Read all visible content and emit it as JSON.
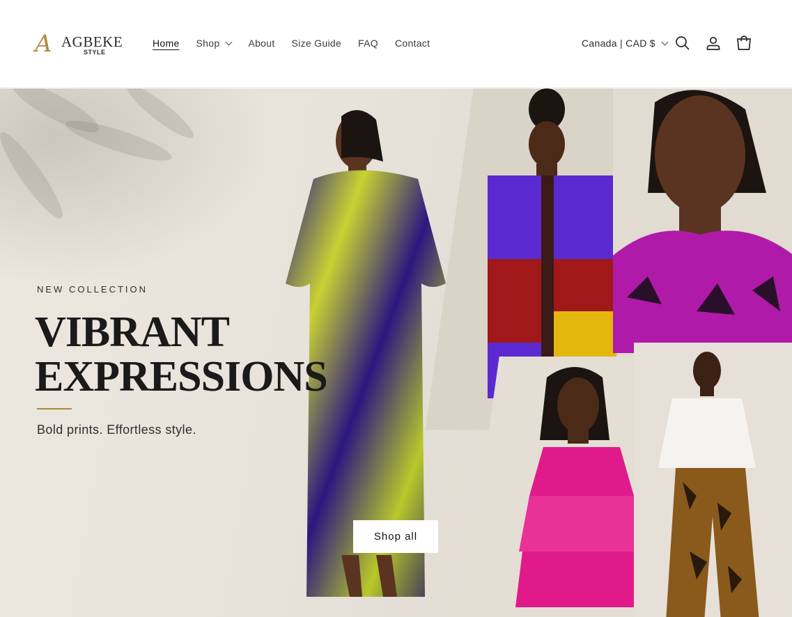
{
  "brand": {
    "logo_mark": "A",
    "name": "AGBEKE",
    "sub": "STYLE"
  },
  "nav": {
    "items": [
      {
        "label": "Home",
        "active": true
      },
      {
        "label": "Shop",
        "has_dropdown": true
      },
      {
        "label": "About"
      },
      {
        "label": "Size Guide"
      },
      {
        "label": "FAQ"
      },
      {
        "label": "Contact"
      }
    ]
  },
  "header_tools": {
    "locale_label": "Canada | CAD $",
    "icons": [
      "search-icon",
      "account-icon",
      "cart-icon"
    ]
  },
  "hero": {
    "eyebrow": "NEW COLLECTION",
    "headline_line1": "VIBRANT",
    "headline_line2": "EXPRESSIONS",
    "tagline": "Bold prints. Effortless style.",
    "cta_label": "Shop all"
  },
  "colors": {
    "accent_gold": "#b08a3e",
    "text_dark": "#121212",
    "hero_bg": "#e7e2da"
  }
}
